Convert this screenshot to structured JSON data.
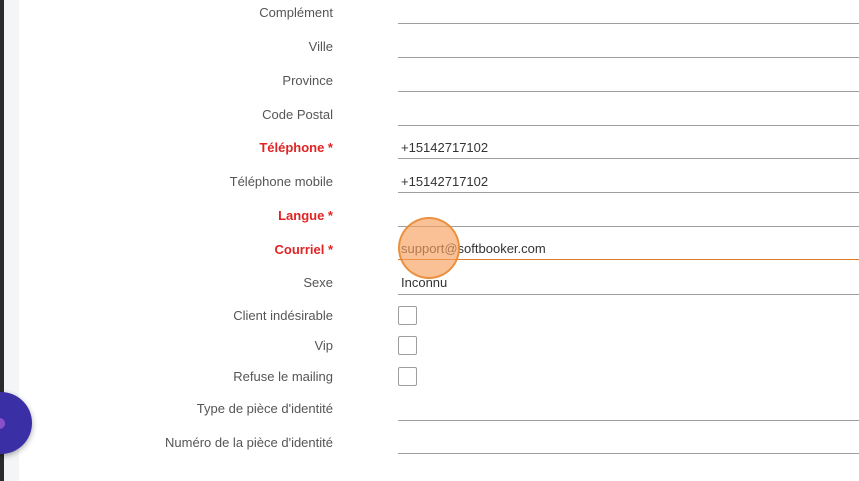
{
  "form": {
    "complement": {
      "label": "Complément",
      "value": ""
    },
    "ville": {
      "label": "Ville",
      "value": ""
    },
    "province": {
      "label": "Province",
      "value": ""
    },
    "code_postal": {
      "label": "Code Postal",
      "value": ""
    },
    "telephone": {
      "label": "Téléphone *",
      "value": "+15142717102"
    },
    "telephone_mobile": {
      "label": "Téléphone mobile",
      "value": "+15142717102"
    },
    "langue": {
      "label": "Langue *",
      "value": ""
    },
    "courriel": {
      "label": "Courriel *",
      "value": "support@softbooker.com"
    },
    "sexe": {
      "label": "Sexe",
      "value": "Inconnu"
    },
    "client_indesirable": {
      "label": "Client indésirable"
    },
    "vip": {
      "label": "Vip"
    },
    "refuse_mailing": {
      "label": "Refuse le mailing"
    },
    "type_piece": {
      "label": "Type de pièce d'identité",
      "value": ""
    },
    "numero_piece": {
      "label": "Numéro de la pièce d'identité",
      "value": ""
    }
  },
  "colors": {
    "required_label": "#e02424",
    "focus_underline": "#e07b2b",
    "click_indicator": "#f6a05c",
    "fab": "#3b2fa5"
  }
}
